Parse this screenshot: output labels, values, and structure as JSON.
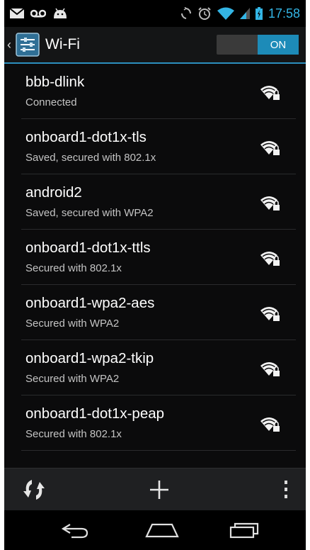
{
  "status_bar": {
    "time": "17:58",
    "left_icons": [
      "mail-icon",
      "voicemail-icon",
      "android-icon"
    ],
    "right_icons": [
      "sync-icon",
      "alarm-icon",
      "wifi-signal-icon",
      "cell-signal-icon",
      "battery-icon"
    ]
  },
  "action_bar": {
    "title": "Wi-Fi",
    "toggle_label": "ON",
    "icon": "settings-app-icon"
  },
  "networks": [
    {
      "ssid": "bbb-dlink",
      "status": "Connected",
      "secured": true
    },
    {
      "ssid": "onboard1-dot1x-tls",
      "status": "Saved, secured with 802.1x",
      "secured": true
    },
    {
      "ssid": "android2",
      "status": "Saved, secured with WPA2",
      "secured": true
    },
    {
      "ssid": "onboard1-dot1x-ttls",
      "status": "Secured with 802.1x",
      "secured": true
    },
    {
      "ssid": "onboard1-wpa2-aes",
      "status": "Secured with WPA2",
      "secured": true
    },
    {
      "ssid": "onboard1-wpa2-tkip",
      "status": "Secured with WPA2",
      "secured": true
    },
    {
      "ssid": "onboard1-dot1x-peap",
      "status": "Secured with 802.1x",
      "secured": true
    }
  ],
  "bottom_bar": [
    "wps-icon",
    "add-icon",
    "overflow-menu-icon"
  ],
  "nav_bar": [
    "back-icon",
    "home-icon",
    "recents-icon"
  ],
  "colors": {
    "accent": "#33b5e5",
    "toggle_on": "#1d8bb8",
    "background": "#0b0b0c"
  }
}
